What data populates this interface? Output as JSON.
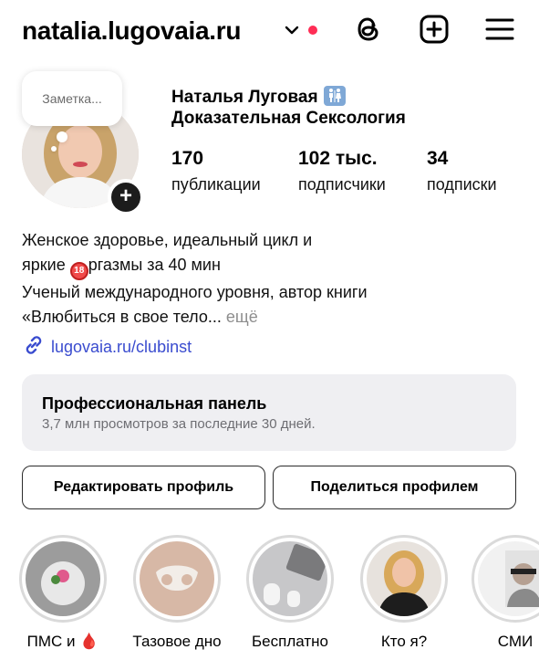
{
  "header": {
    "username": "natalia.lugovaia.ru",
    "icons": [
      "chevron-down-icon",
      "threads-icon",
      "add-post-icon",
      "menu-icon"
    ],
    "unread_dot_color": "#ff2d55"
  },
  "profile": {
    "note": "Заметка...",
    "name": "Наталья Луговая",
    "category": "Доказательная Сексология",
    "stats": [
      {
        "value": "170",
        "label": "публикации"
      },
      {
        "value": "102 тыс.",
        "label": "подписчики"
      },
      {
        "value": "34",
        "label": "подписки"
      }
    ],
    "bio_line1": "Женское здоровье, идеальный цикл и",
    "bio_line2_pre": "яркие ",
    "bio_badge": "18",
    "bio_line2_post": "ргазмы за 40 мин",
    "bio_line3": "Ученый международного уровня, автор книги",
    "bio_line4": "«Влюбиться в свое тело...",
    "bio_more": "ещё",
    "link": "lugovaia.ru/clubinst"
  },
  "panel": {
    "title": "Профессиональная панель",
    "subtitle": "3,7 млн просмотров за последние 30 дней."
  },
  "buttons": {
    "edit": "Редактировать профиль",
    "share": "Поделиться профилем"
  },
  "highlights": [
    {
      "label": "ПМС и 🩸"
    },
    {
      "label": "Тазовое дно"
    },
    {
      "label": "Бесплатно"
    },
    {
      "label": "Кто я?"
    },
    {
      "label": "СМИ"
    }
  ],
  "colors": {
    "link": "#3a4ccf",
    "panel_bg": "#efeff2",
    "muted": "#8e8e8e"
  }
}
